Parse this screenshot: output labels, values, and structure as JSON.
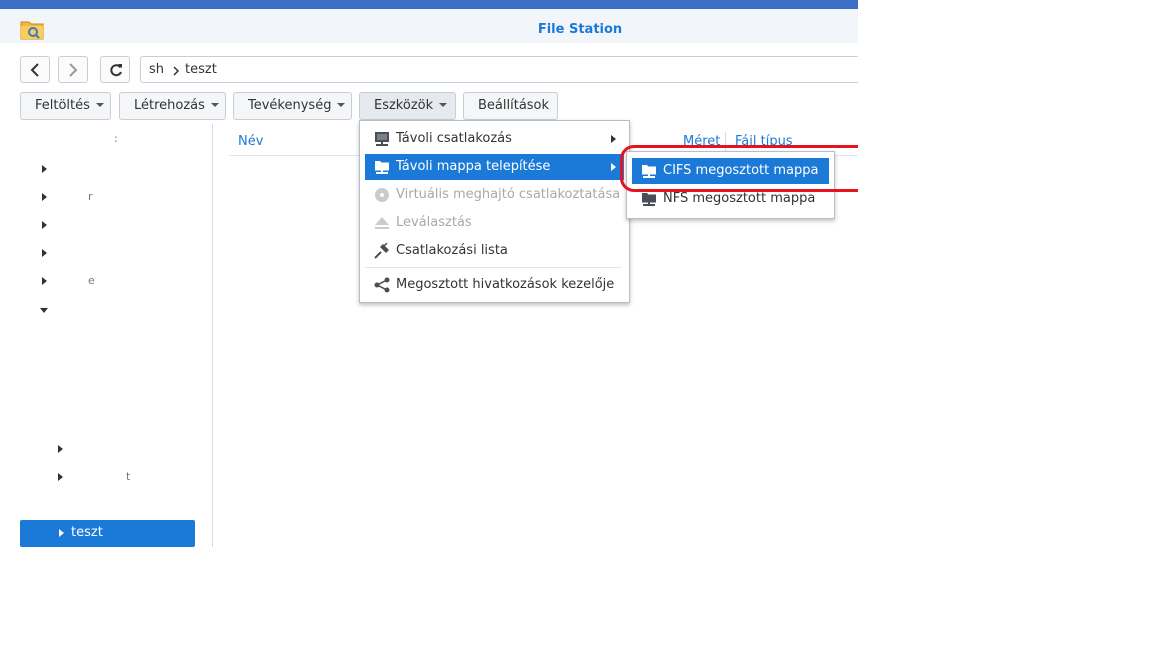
{
  "window": {
    "title": "File Station",
    "accent": "#1b7ad8",
    "titlebar_border": "#3c6ec8"
  },
  "nav": {
    "back_icon": "chevron-left-icon",
    "forward_icon": "chevron-right-icon",
    "refresh_icon": "refresh-icon",
    "path": [
      "sh",
      "teszt"
    ]
  },
  "toolbar": {
    "upload": "Feltöltés",
    "create": "Létrehozás",
    "action": "Tevékenység",
    "tools": "Eszközök",
    "settings": "Beállítások"
  },
  "tree": {
    "selected": "teszt"
  },
  "grid": {
    "columns": [
      "Név",
      "Méret",
      "Fájl típus"
    ]
  },
  "tools_menu": {
    "items": [
      {
        "label": "Távoli csatlakozás",
        "icon": "remote-connection-icon",
        "submenu": true
      },
      {
        "label": "Távoli mappa telepítése",
        "icon": "remote-folder-icon",
        "submenu": true,
        "active": true
      },
      {
        "label": "Virtuális meghajtó csatlakoztatása",
        "icon": "disc-icon",
        "disabled": true
      },
      {
        "label": "Leválasztás",
        "icon": "eject-icon",
        "disabled": true
      },
      {
        "label": "Csatlakozási lista",
        "icon": "plug-icon"
      },
      {
        "label": "Megosztott hivatkozások kezelője",
        "icon": "share-icon"
      }
    ]
  },
  "submenu": {
    "items": [
      {
        "label": "CIFS megosztott mappa",
        "icon": "network-folder-icon",
        "active": true
      },
      {
        "label": "NFS megosztott mappa",
        "icon": "network-folder-icon"
      }
    ]
  },
  "annotation_color": "#e3141d"
}
